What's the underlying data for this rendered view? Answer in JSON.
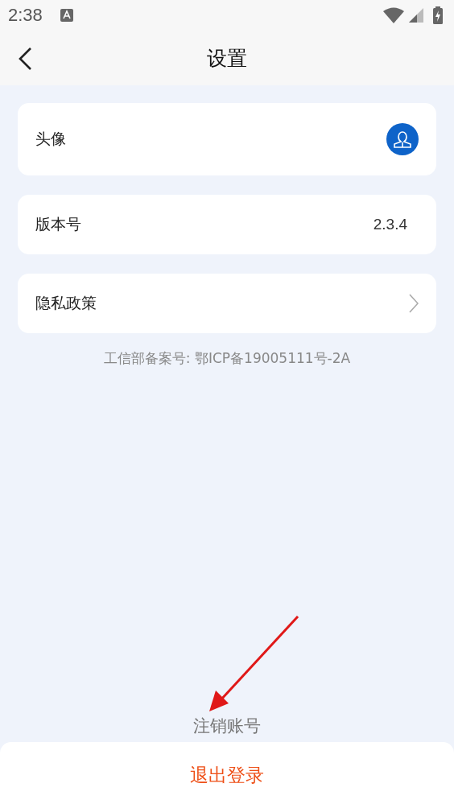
{
  "status_bar": {
    "time": "2:38"
  },
  "header": {
    "title": "设置"
  },
  "rows": [
    {
      "kind": "avatar",
      "label": "头像"
    },
    {
      "kind": "value",
      "label": "版本号",
      "value": "2.3.4"
    },
    {
      "kind": "link",
      "label": "隐私政策"
    }
  ],
  "icp_note": "工信部备案号: 鄂ICP备19005111号-2A",
  "cancel_account": "注销账号",
  "logout_button": "退出登录"
}
